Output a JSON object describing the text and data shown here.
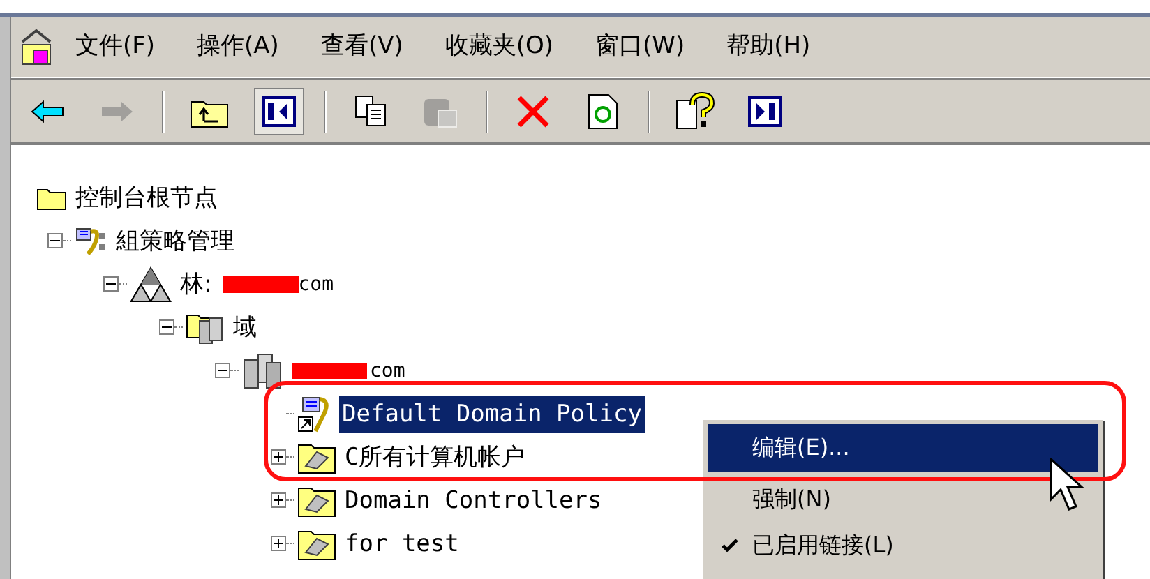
{
  "menu_bar": {
    "items": [
      {
        "label": "文件(F)"
      },
      {
        "label": "操作(A)"
      },
      {
        "label": "查看(V)"
      },
      {
        "label": "收藏夹(O)"
      },
      {
        "label": "窗口(W)"
      },
      {
        "label": "帮助(H)"
      }
    ]
  },
  "toolbar": {
    "buttons": [
      {
        "kind": "back",
        "disabled": false,
        "pressed": false
      },
      {
        "kind": "forward",
        "disabled": true,
        "pressed": false
      },
      {
        "kind": "separator"
      },
      {
        "kind": "up",
        "disabled": false,
        "pressed": false
      },
      {
        "kind": "tree",
        "disabled": false,
        "pressed": true
      },
      {
        "kind": "separator"
      },
      {
        "kind": "copy",
        "disabled": false,
        "pressed": false
      },
      {
        "kind": "paste",
        "disabled": true,
        "pressed": false
      },
      {
        "kind": "separator"
      },
      {
        "kind": "delete",
        "disabled": false,
        "pressed": false
      },
      {
        "kind": "refresh",
        "disabled": false,
        "pressed": false
      },
      {
        "kind": "separator"
      },
      {
        "kind": "help",
        "disabled": false,
        "pressed": false
      },
      {
        "kind": "pane",
        "disabled": false,
        "pressed": false
      }
    ]
  },
  "tree": [
    {
      "label": "控制台根节点",
      "kind": "folder",
      "selected": false,
      "children": [
        {
          "label": "組策略管理",
          "kind": "gpm",
          "expanded": true,
          "selected": false,
          "children": [
            {
              "label": "林:",
              "suffix": "com",
              "redacted": true,
              "kind": "forest",
              "expanded": true,
              "selected": false,
              "children": [
                {
                  "label": "域",
                  "kind": "domains",
                  "expanded": true,
                  "selected": false,
                  "children": [
                    {
                      "label": "com",
                      "redacted": true,
                      "kind": "domain",
                      "expanded": true,
                      "selected": false,
                      "children": [
                        {
                          "label": "Default Domain Policy",
                          "kind": "link",
                          "selected": true
                        },
                        {
                          "label": "C所有计算机帐户",
                          "kind": "ou",
                          "expanded": false,
                          "selected": false
                        },
                        {
                          "label": "Domain Controllers",
                          "kind": "ou",
                          "expanded": false,
                          "selected": false
                        },
                        {
                          "label": "for test",
                          "kind": "ou",
                          "expanded": false,
                          "selected": false
                        }
                      ]
                    }
                  ]
                }
              ]
            }
          ]
        }
      ]
    }
  ],
  "context_menu": {
    "items": [
      {
        "label": "编辑(E)...",
        "selected": true,
        "checked": false
      },
      {
        "label": "强制(N)",
        "selected": false,
        "checked": false
      },
      {
        "label": "已启用链接(L)",
        "selected": false,
        "checked": true
      }
    ]
  }
}
